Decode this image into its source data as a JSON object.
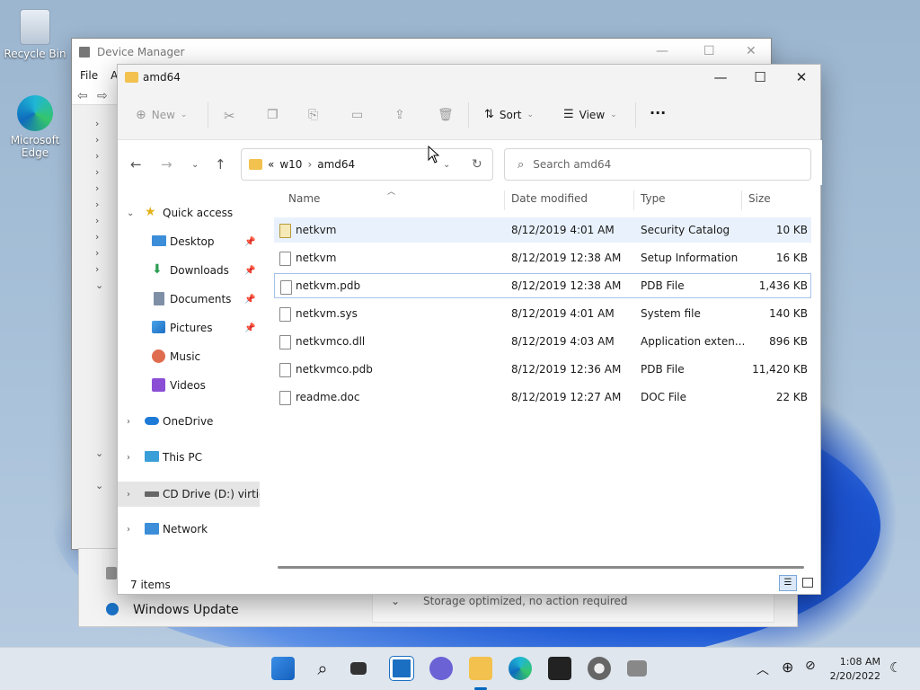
{
  "desktop": {
    "icons": [
      {
        "label": "Recycle Bin"
      },
      {
        "label": "Microsoft Edge"
      }
    ]
  },
  "device_manager": {
    "title": "Device Manager",
    "menu": [
      "File",
      "A"
    ],
    "controls": {
      "minimize": "—",
      "maximize": "☐",
      "close": "✕"
    }
  },
  "windows_update": {
    "label": "Windows Update",
    "card_text": "Storage optimized, no action required"
  },
  "explorer": {
    "title": "amd64",
    "controls": {
      "minimize": "—",
      "maximize": "☐",
      "close": "✕"
    },
    "commands": {
      "new": "New",
      "sort": "Sort",
      "view": "View",
      "more": "···"
    },
    "address": {
      "overflow": "«",
      "crumbs": [
        "w10",
        "amd64"
      ]
    },
    "search_placeholder": "Search amd64",
    "nav": {
      "quick_access": "Quick access",
      "quick_items": [
        "Desktop",
        "Downloads",
        "Documents",
        "Pictures",
        "Music",
        "Videos"
      ],
      "onedrive": "OneDrive",
      "this_pc": "This PC",
      "cd_drive": "CD Drive (D:) virtio-w",
      "network": "Network"
    },
    "columns": {
      "name": "Name",
      "date": "Date modified",
      "type": "Type",
      "size": "Size"
    },
    "files": [
      {
        "name": "netkvm",
        "date": "8/12/2019 4:01 AM",
        "type": "Security Catalog",
        "size": "10 KB"
      },
      {
        "name": "netkvm",
        "date": "8/12/2019 12:38 AM",
        "type": "Setup Information",
        "size": "16 KB"
      },
      {
        "name": "netkvm.pdb",
        "date": "8/12/2019 12:38 AM",
        "type": "PDB File",
        "size": "1,436 KB"
      },
      {
        "name": "netkvm.sys",
        "date": "8/12/2019 4:01 AM",
        "type": "System file",
        "size": "140 KB"
      },
      {
        "name": "netkvmco.dll",
        "date": "8/12/2019 4:03 AM",
        "type": "Application exten...",
        "size": "896 KB"
      },
      {
        "name": "netkvmco.pdb",
        "date": "8/12/2019 12:36 AM",
        "type": "PDB File",
        "size": "11,420 KB"
      },
      {
        "name": "readme.doc",
        "date": "8/12/2019 12:27 AM",
        "type": "DOC File",
        "size": "22 KB"
      }
    ],
    "status": "7 items"
  },
  "taskbar": {
    "time": "1:08 AM",
    "date": "2/20/2022"
  },
  "colors": {
    "accent": "#0067c0",
    "folder": "#f2c14e",
    "selection": "#e9f2fc"
  }
}
